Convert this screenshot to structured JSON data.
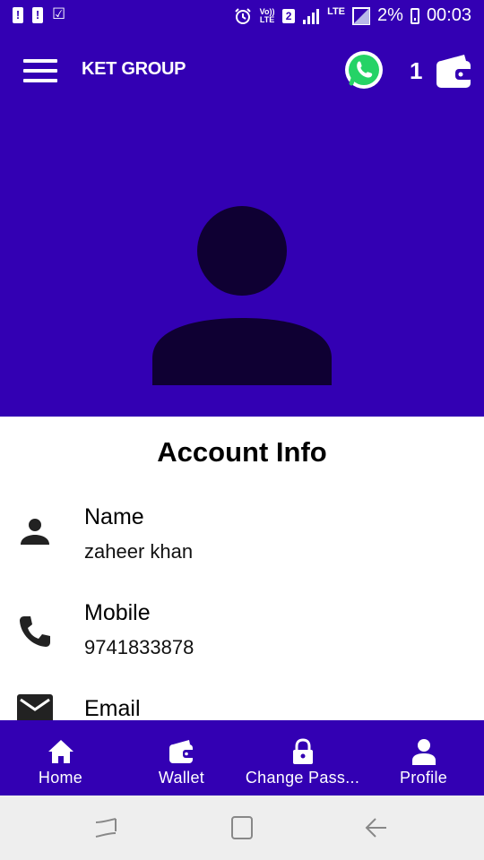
{
  "status_bar": {
    "volte_label": "Vo)) LTE",
    "sim_number": "2",
    "network_label": "LTE",
    "battery": "2%",
    "time": "00:03",
    "icons": [
      "alert-icon",
      "alert-icon",
      "check-icon",
      "alarm-icon",
      "signal-icon",
      "battery-icon"
    ]
  },
  "app_bar": {
    "title": "KET GROUP",
    "wallet_count": "1",
    "icons": [
      "menu-icon",
      "whatsapp-icon",
      "wallet-icon"
    ]
  },
  "account": {
    "section_title": "Account Info",
    "fields": [
      {
        "label": "Name",
        "value": "zaheer khan",
        "icon": "person-icon"
      },
      {
        "label": "Mobile",
        "value": "9741833878",
        "icon": "phone-icon"
      },
      {
        "label": "Email",
        "value": "",
        "icon": "email-icon"
      }
    ]
  },
  "bottom_nav": {
    "items": [
      {
        "label": "Home",
        "icon": "home-icon"
      },
      {
        "label": "Wallet",
        "icon": "wallet-icon"
      },
      {
        "label": "Change Pass...",
        "icon": "lock-icon"
      },
      {
        "label": "Profile",
        "icon": "profile-icon"
      }
    ]
  },
  "colors": {
    "primary": "#3300b3",
    "avatar": "#0f0033",
    "whatsapp": "#25d366",
    "system_nav_bg": "#eeeeee"
  }
}
